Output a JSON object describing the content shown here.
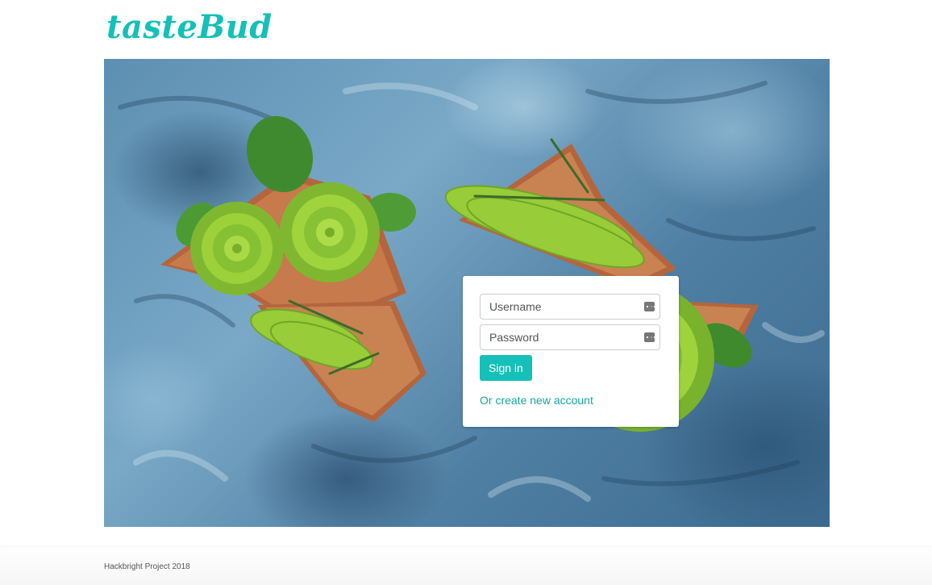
{
  "brand": {
    "logo_text": "tasteBud"
  },
  "hero": {
    "image_description_icon": "avocado-toast-photo"
  },
  "login": {
    "username_placeholder": "Username",
    "password_placeholder": "Password",
    "signin_label": "Sign in",
    "create_account_label": "Or create new account"
  },
  "footer": {
    "text": "Hackbright Project 2018"
  },
  "colors": {
    "accent": "#14c0b8",
    "link": "#14a89f"
  }
}
